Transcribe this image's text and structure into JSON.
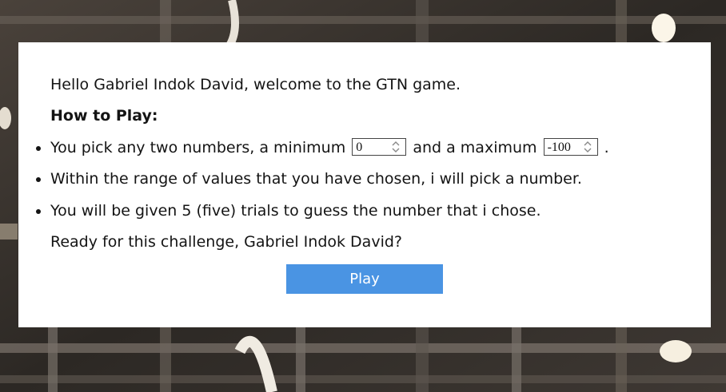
{
  "greeting": "Hello Gabriel Indok David, welcome to the GTN game.",
  "how_to_play": "How to Play:",
  "rules": {
    "pick_prefix": "You pick any two numbers, a minimum",
    "pick_middle": "and a maximum",
    "pick_suffix": ".",
    "range": "Within the range of values that you have chosen, i will pick a number.",
    "trials": "You will be given 5 (five) trials to guess the number that i chose."
  },
  "inputs": {
    "minimum_value": "0",
    "maximum_value": "-100"
  },
  "challenge": "Ready for this challenge, Gabriel Indok David?",
  "play_button": "Play",
  "colors": {
    "button": "#4a94e3",
    "card": "#ffffff"
  }
}
